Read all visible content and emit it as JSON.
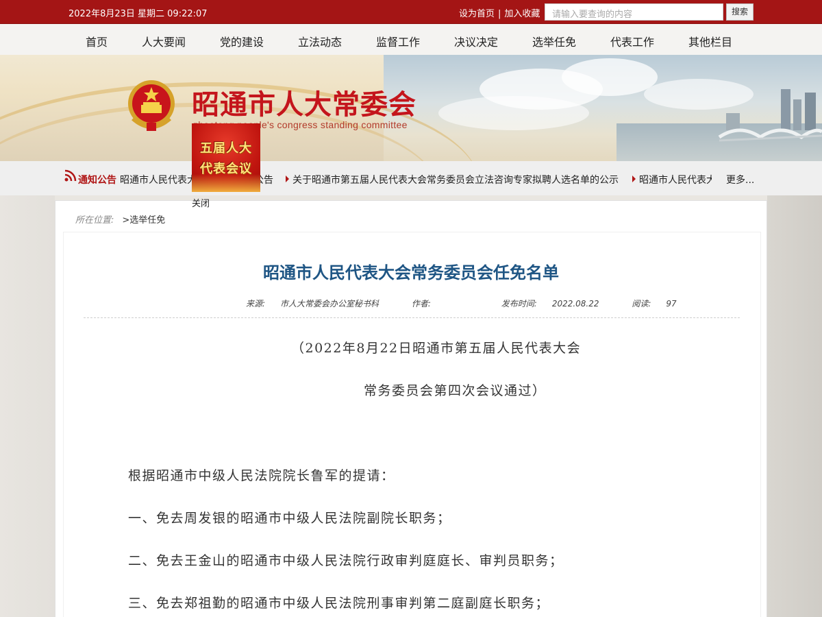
{
  "topbar": {
    "datetime": "2022年8月23日 星期二 09:22:07",
    "set_home": "设为首页",
    "separator": "|",
    "bookmark": "加入收藏",
    "search_placeholder": "请输入要查询的内容",
    "search_button": "搜索"
  },
  "nav": {
    "items": [
      "首页",
      "人大要闻",
      "党的建设",
      "立法动态",
      "监督工作",
      "决议决定",
      "选举任免",
      "代表工作",
      "其他栏目"
    ]
  },
  "banner": {
    "title": "昭通市人大常委会",
    "subtitle": "zhaotong people's congress standing committee"
  },
  "notice": {
    "label": "通知公告",
    "items": [
      "昭通市人民代表大会常务委员会公告",
      "关于昭通市第五届人民代表大会常务委员会立法咨询专家拟聘人选名单的公示",
      "昭通市人民代表大会常务委员会公告"
    ],
    "more": "更多..."
  },
  "float_ad": {
    "line1": "五届人大",
    "line2": "代表会议",
    "close": "关闭"
  },
  "breadcrumb": {
    "label": "所在位置:",
    "current": ">选举任免"
  },
  "article": {
    "title": "昭通市人民代表大会常务委员会任免名单",
    "source_label": "来源:",
    "source": "市人大常委会办公室秘书科",
    "author_label": "作者:",
    "author": "",
    "date_label": "发布时间:",
    "date": "2022.08.22",
    "views_label": "阅读:",
    "views": "97",
    "subtitle_line1": "（2022年8月22日昭通市第五届人民代表大会",
    "subtitle_line2": "常务委员会第四次会议通过）",
    "paragraphs": [
      "根据昭通市中级人民法院院长鲁军的提请：",
      "一、免去周发银的昭通市中级人民法院副院长职务；",
      "二、免去王金山的昭通市中级人民法院行政审判庭庭长、审判员职务；",
      "三、免去郑祖勤的昭通市中级人民法院刑事审判第二庭副庭长职务；"
    ]
  },
  "colors": {
    "topbar_bg": "#a41515",
    "title_red": "#c4151c",
    "article_title_blue": "#1e5584",
    "notice_red": "#b01616"
  }
}
